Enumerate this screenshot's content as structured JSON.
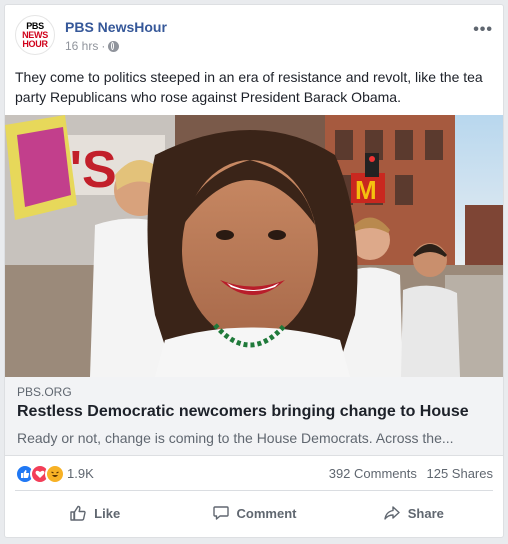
{
  "post": {
    "page_name": "PBS NewsHour",
    "avatar": {
      "line1": "PBS",
      "line2": "NEWS",
      "line3": "HOUR"
    },
    "time": "16 hrs",
    "separator": "·",
    "privacy_icon": "globe-icon",
    "more_icon": "more-options-icon",
    "more_label": "•••",
    "text": "They come to politics steeped in an era of resistance and revolt, like the tea party Republicans who rose against President Barack Obama."
  },
  "link": {
    "domain": "PBS.ORG",
    "title": "Restless Democratic newcomers bringing change to House",
    "description": "Ready or not, change is coming to the House Democrats. Across the..."
  },
  "stats": {
    "reaction_icons": [
      "like-reaction-icon",
      "love-reaction-icon",
      "haha-reaction-icon"
    ],
    "reaction_count": "1.9K",
    "comments": "392 Comments",
    "shares": "125 Shares"
  },
  "actions": {
    "like": "Like",
    "comment": "Comment",
    "share": "Share"
  },
  "colors": {
    "page_link": "#365899",
    "like_blue": "#2078f4",
    "love_red": "#f33e58",
    "haha_yellow": "#f7b125",
    "link_box_bg": "#f2f3f5"
  }
}
